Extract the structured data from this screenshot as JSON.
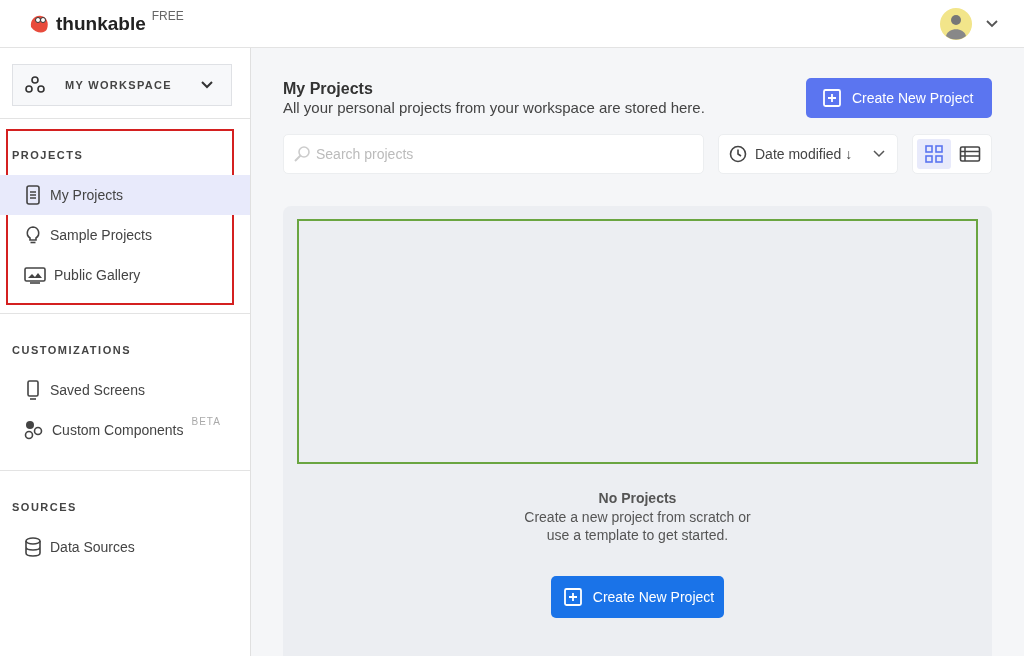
{
  "header": {
    "brand": "thunkable",
    "plan": "FREE"
  },
  "workspace": {
    "label": "MY WORKSPACE"
  },
  "sidebar": {
    "sections": [
      {
        "title": "PROJECTS",
        "highlighted": true,
        "items": [
          {
            "label": "My Projects",
            "kind": "phone-doc",
            "selected": true
          },
          {
            "label": "Sample Projects",
            "kind": "bulb",
            "selected": false
          },
          {
            "label": "Public Gallery",
            "kind": "gallery",
            "selected": false
          }
        ]
      },
      {
        "title": "CUSTOMIZATIONS",
        "highlighted": false,
        "items": [
          {
            "label": "Saved Screens",
            "kind": "phone",
            "selected": false
          },
          {
            "label": "Custom Components",
            "kind": "circles",
            "selected": false,
            "badge": "BETA"
          }
        ]
      },
      {
        "title": "SOURCES",
        "highlighted": false,
        "items": [
          {
            "label": "Data Sources",
            "kind": "database",
            "selected": false
          }
        ]
      }
    ]
  },
  "page": {
    "title": "My Projects",
    "subtitle": "All your personal projects from your workspace are stored here.",
    "create_button": "Create New Project"
  },
  "search": {
    "placeholder": "Search projects"
  },
  "sort": {
    "label": "Date modified ↓"
  },
  "views": [
    {
      "kind": "grid",
      "selected": true
    },
    {
      "kind": "list",
      "selected": false
    }
  ],
  "empty_state": {
    "title": "No Projects",
    "text": "Create a new project from scratch or use a template to get started.",
    "button": "Create New Project"
  }
}
